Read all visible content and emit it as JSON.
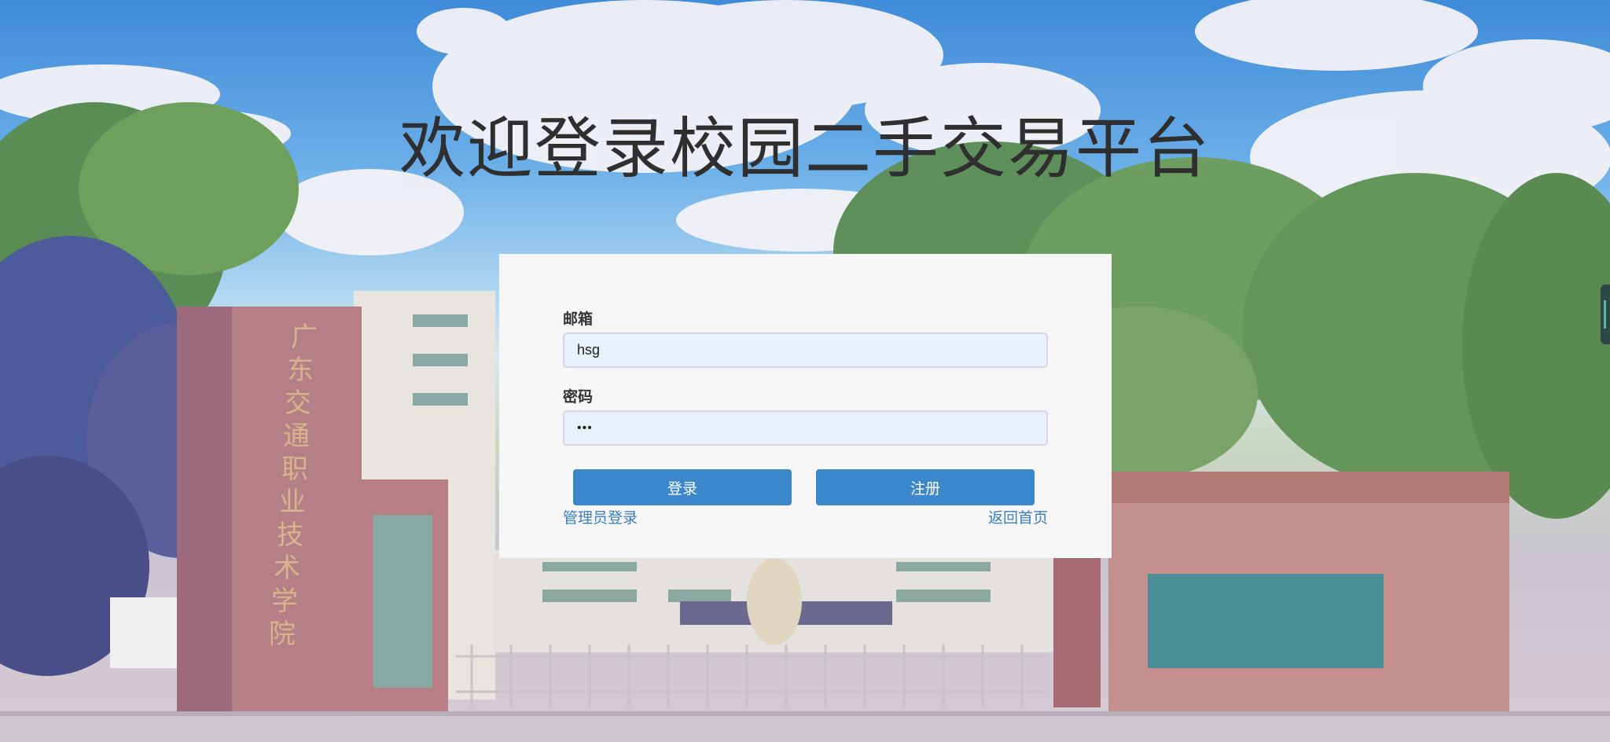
{
  "page": {
    "title": "欢迎登录校园二手交易平台"
  },
  "form": {
    "email_label": "邮箱",
    "email_value": "hsg",
    "password_label": "密码",
    "password_value": "•••",
    "login_button": "登录",
    "register_button": "注册",
    "admin_login_link": "管理员登录",
    "back_home_link": "返回首页"
  },
  "background": {
    "gate_inscription": "广东交通职业技术学院"
  },
  "colors": {
    "button": "#3b87cb",
    "link": "#3b7fbf",
    "input_bg": "#e8f0fe",
    "card_bg": "#f6f6f6"
  }
}
